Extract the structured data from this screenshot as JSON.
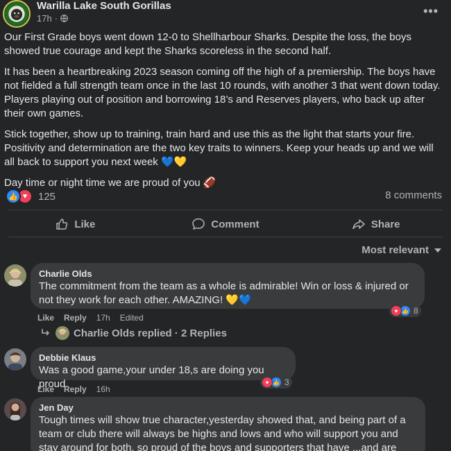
{
  "post": {
    "page_name": "Warilla Lake South Gorillas",
    "time": "17h",
    "paragraphs": [
      "Our First Grade boys went down 12-0 to Shellharbour Sharks. Despite the loss, the boys showed true courage and kept the Sharks scoreless in the second half.",
      "It has been a heartbreaking 2023 season coming off the high of a premiership. The boys have not fielded a full strength team once in the last 10 rounds, with another 3 that went down today. Players playing out of position and borrowing 18’s and Reserves players, who back up after their own games.",
      "Stick together, show up to training, train hard and use this as the light that starts your fire. Positivity and determination are the two key traits to winners. Keep your heads up and we will all back to support you next week 💙💛",
      "Day time or night time we are proud of you 🏈"
    ],
    "reaction_count": "125",
    "comments_count": "8 comments"
  },
  "actions": {
    "like": "Like",
    "comment": "Comment",
    "share": "Share"
  },
  "sort_label": "Most relevant",
  "comments": [
    {
      "name": "Charlie Olds",
      "text": "The commitment from the team as a whole is admirable! Win or loss & injured or not they work for each other. AMAZING! 💛💙",
      "like": "Like",
      "reply": "Reply",
      "time": "17h",
      "edited": "Edited",
      "reactions": "8"
    },
    {
      "name": "Debbie Klaus",
      "text": "Was a good game,your under 18,s are doing you proud.",
      "like": "Like",
      "reply": "Reply",
      "time": "16h",
      "reactions": "3"
    },
    {
      "name": "Jen Day",
      "text": "Tough times will show true character,yesterday showed that, and being part of a team or club there will always be highs and lows and who will support you and stay around for both, so proud of the boys and supporters that have ...and are doing that"
    }
  ],
  "replies_summary": {
    "text": "Charlie Olds replied · 2 Replies"
  },
  "colors": {
    "background": "#242526",
    "bubble": "#3a3b3c",
    "like_blue": "#2d88ff",
    "love_red": "#f33e58"
  }
}
